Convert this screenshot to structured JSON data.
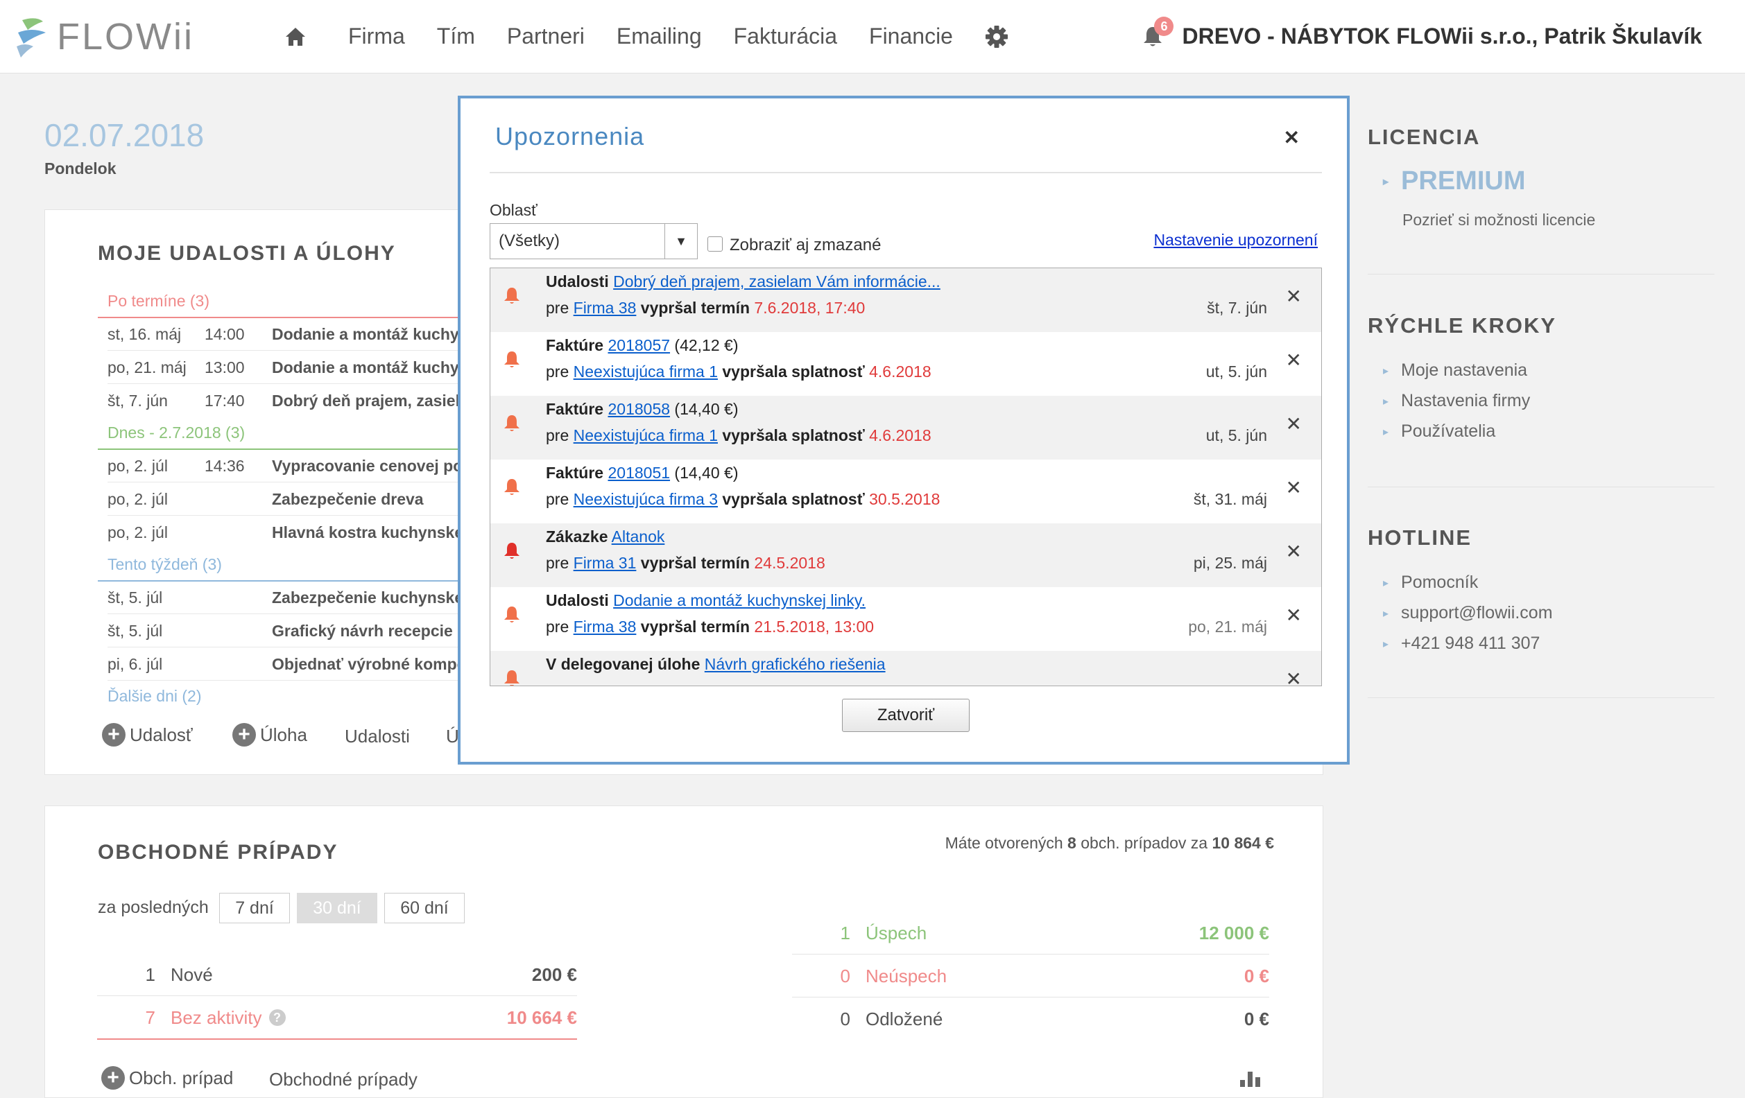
{
  "brand": {
    "name": "FLOWii"
  },
  "nav": {
    "items": [
      "Firma",
      "Tím",
      "Partneri",
      "Emailing",
      "Fakturácia",
      "Financie"
    ]
  },
  "notifications_count": "6",
  "company_user": "DREVO - NÁBYTOK FLOWii s.r.o., Patrik Škulavík",
  "date": "02.07.2018",
  "weekday": "Pondelok",
  "events_panel": {
    "title": "MOJE UDALOSTI A ÚLOHY",
    "sections": [
      {
        "label": "Po termíne (3)",
        "color": "#f08a8a",
        "rows": [
          {
            "date": "st, 16. máj",
            "time": "14:00",
            "name": "Dodanie a montáž kuchynskej"
          },
          {
            "date": "po, 21. máj",
            "time": "13:00",
            "name": "Dodanie a montáž kuchynskej"
          },
          {
            "date": "št, 7. jún",
            "time": "17:40",
            "name": "Dobrý deň prajem, zasielam"
          }
        ]
      },
      {
        "label": "Dnes - 2.7.2018 (3)",
        "color": "#8cc47a",
        "rows": [
          {
            "date": "po, 2. júl",
            "time": "14:36",
            "name": "Vypracovanie cenovej ponuky"
          },
          {
            "date": "po, 2. júl",
            "time": "",
            "name": "Zabezpečenie dreva"
          },
          {
            "date": "po, 2. júl",
            "time": "",
            "name": "Hlavná kostra kuchynskej"
          }
        ]
      },
      {
        "label": "Tento týždeň (3)",
        "color": "#8fb8dc",
        "rows": [
          {
            "date": "št, 5. júl",
            "time": "",
            "name": "Zabezpečenie kuchynskej"
          },
          {
            "date": "št, 5. júl",
            "time": "",
            "name": "Grafický návrh recepcie"
          },
          {
            "date": "pi, 6. júl",
            "time": "",
            "name": "Objednať výrobné komponenty"
          }
        ]
      }
    ],
    "more_label": "Ďalšie dni (2)",
    "actions": {
      "add_event": "Udalosť",
      "add_task": "Úloha",
      "events_link": "Udalosti",
      "tasks_link": "Ú"
    }
  },
  "business_panel": {
    "title": "OBCHODNÉ PRÍPADY",
    "summary_prefix": "Máte otvorených ",
    "summary_count": "8",
    "summary_mid": " obch. prípadov za ",
    "summary_value": "10 864 €",
    "period_label": "za posledných",
    "periods": [
      "7 dní",
      "30 dní",
      "60 dní"
    ],
    "left_stats": [
      {
        "count": "1",
        "label": "Nové",
        "value": "200 €",
        "color": "#555555"
      },
      {
        "count": "7",
        "label": "Bez aktivity",
        "value": "10 664 €",
        "color": "#f08a8a"
      }
    ],
    "right_stats": [
      {
        "count": "1",
        "label": "Úspech",
        "value": "12 000 €",
        "color": "#8cc47a"
      },
      {
        "count": "0",
        "label": "Neúspech",
        "value": "0 €",
        "color": "#f08a8a"
      },
      {
        "count": "0",
        "label": "Odložené",
        "value": "0 €",
        "color": "#555555"
      }
    ],
    "actions": {
      "add_case": "Obch. prípad",
      "cases_link": "Obchodné prípady"
    }
  },
  "sidebar": {
    "licencia": {
      "title": "LICENCIA",
      "plan": "PREMIUM",
      "link": "Pozrieť si možnosti licencie"
    },
    "quick_steps": {
      "title": "RÝCHLE KROKY",
      "items": [
        "Moje nastavenia",
        "Nastavenia firmy",
        "Používatelia"
      ]
    },
    "hotline": {
      "title": "HOTLINE",
      "items": [
        "Pomocník",
        "support@flowii.com",
        "+421 948 411 307"
      ]
    }
  },
  "modal": {
    "title": "Upozornenia",
    "oblast_label": "Oblasť",
    "select_value": "(Všetky)",
    "show_deleted_label": "Zobraziť aj zmazané",
    "settings_link": "Nastavenie upozornení",
    "close_button": "Zatvoriť",
    "notifications": [
      {
        "kind": "Udalosti",
        "ref": "Dobrý deň prajem, zasielam Vám informácie...",
        "ref_extra": "",
        "partner": "Firma 38",
        "status": "vypršal termín",
        "deadline": "7.6.2018, 17:40",
        "date": "št, 7. jún",
        "bell_color": "#f0704a"
      },
      {
        "kind": "Faktúre",
        "ref": "2018057",
        "ref_extra": " (42,12 €)",
        "partner": "Neexistujúca firma 1",
        "status": "vypršala splatnosť",
        "deadline": "4.6.2018",
        "date": "ut, 5. jún",
        "bell_color": "#f0704a"
      },
      {
        "kind": "Faktúre",
        "ref": "2018058",
        "ref_extra": " (14,40 €)",
        "partner": "Neexistujúca firma 1",
        "status": "vypršala splatnosť",
        "deadline": "4.6.2018",
        "date": "ut, 5. jún",
        "bell_color": "#f0704a"
      },
      {
        "kind": "Faktúre",
        "ref": "2018051",
        "ref_extra": " (14,40 €)",
        "partner": "Neexistujúca firma 3",
        "status": "vypršala splatnosť",
        "deadline": "30.5.2018",
        "date": "št, 31. máj",
        "bell_color": "#f0704a"
      },
      {
        "kind": "Zákazke",
        "ref": "Altanok",
        "ref_extra": "",
        "partner": "Firma 31",
        "status": "vypršal termín",
        "deadline": "24.5.2018",
        "date": "pi, 25. máj",
        "bell_color": "#e0302a"
      },
      {
        "kind": "Udalosti",
        "ref": "Dodanie a montáž kuchynskej linky.",
        "ref_extra": "",
        "partner": "Firma 38",
        "status": "vypršal termín",
        "deadline": "21.5.2018, 13:00",
        "date": "po, 21. máj",
        "bell_color": "#f0704a"
      },
      {
        "kind": "V delegovanej úlohe",
        "ref": "Návrh grafického riešenia",
        "ref_extra": "",
        "partner": "",
        "status": "",
        "deadline": "",
        "date": "",
        "bell_color": "#f0704a"
      }
    ]
  },
  "colors": {
    "accent": "#4a88c0",
    "link": "#0b5fcc",
    "deadline": "#e03a3a",
    "bell": "#f0704a"
  }
}
